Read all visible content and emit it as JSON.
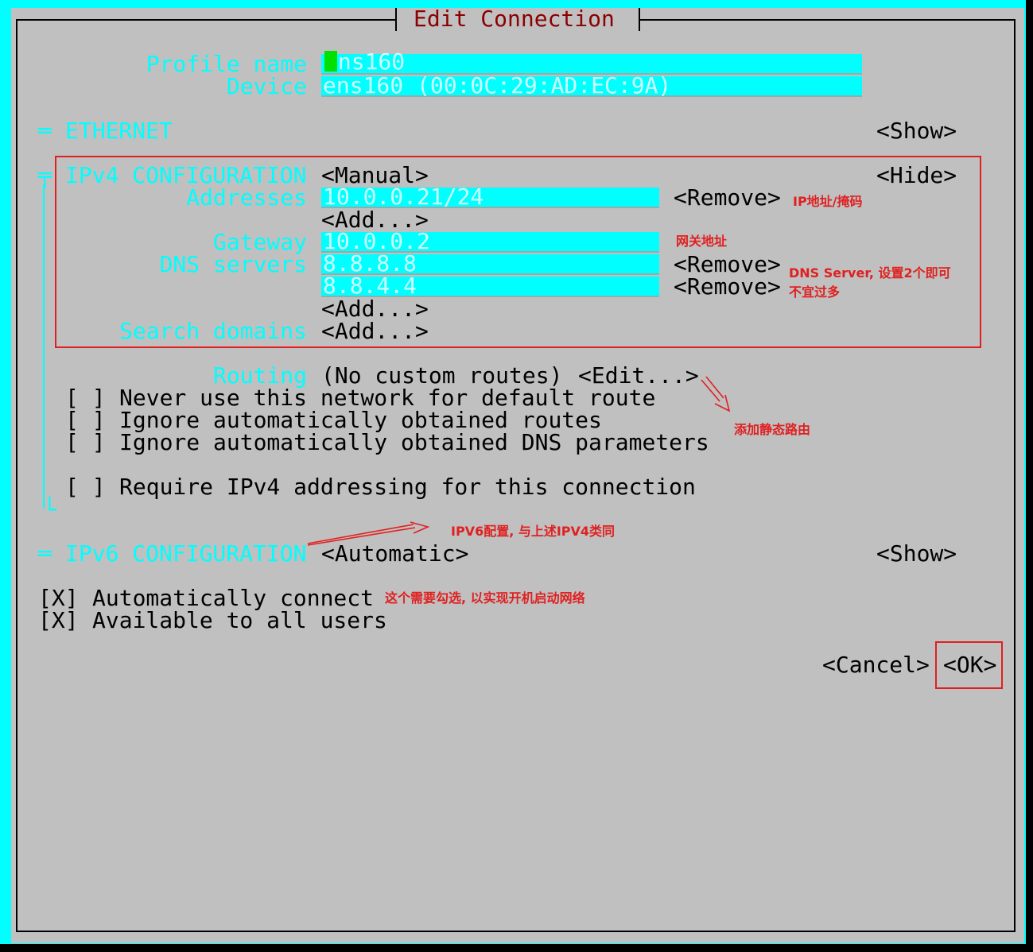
{
  "dialog": {
    "title": "Edit Connection"
  },
  "profile": {
    "name_label": "Profile name",
    "name_value": "ens160",
    "device_label": "Device",
    "device_value": "ens160 (00:0C:29:AD:EC:9A)"
  },
  "ethernet": {
    "label": "ETHERNET",
    "toggle": "<Show>"
  },
  "ipv4": {
    "label": "IPv4 CONFIGURATION",
    "method": "<Manual>",
    "toggle": "<Hide>",
    "addresses_label": "Addresses",
    "address": "10.0.0.21/24",
    "remove": "<Remove>",
    "add": "<Add...>",
    "gateway_label": "Gateway",
    "gateway": "10.0.0.2",
    "dns_label": "DNS servers",
    "dns": [
      "8.8.8.8",
      "8.8.4.4"
    ],
    "search_label": "Search domains",
    "routing_label": "Routing",
    "routing_value": "(No custom routes)",
    "routing_edit": "<Edit...>",
    "checkboxes": [
      {
        "box": "[ ]",
        "label": "Never use this network for default route"
      },
      {
        "box": "[ ]",
        "label": "Ignore automatically obtained routes"
      },
      {
        "box": "[ ]",
        "label": "Ignore automatically obtained DNS parameters"
      },
      {
        "box": "[ ]",
        "label": "Require IPv4 addressing for this connection"
      }
    ]
  },
  "ipv6": {
    "label": "IPv6 CONFIGURATION",
    "method": "<Automatic>",
    "toggle": "<Show>"
  },
  "options": [
    {
      "box": "[X]",
      "label": "Automatically connect"
    },
    {
      "box": "[X]",
      "label": "Available to all users"
    }
  ],
  "buttons": {
    "cancel": "<Cancel>",
    "ok": "<OK>"
  },
  "annotations": {
    "ip_mask": "IP地址/掩码",
    "gateway": "网关地址",
    "dns_line1": "DNS Server, 设置2个即可",
    "dns_line2": "不宜过多",
    "static_route": "添加静态路由",
    "ipv6": "IPV6配置, 与上述IPV4类同",
    "autoconnect": "这个需要勾选, 以实现开机启动网络"
  },
  "colors": {
    "label": "#00ffff",
    "field": "#00ffff",
    "dialog_bg": "#c0c0c0",
    "title": "#8b0000",
    "annotation": "#e02020",
    "cursor": "#00e000"
  }
}
